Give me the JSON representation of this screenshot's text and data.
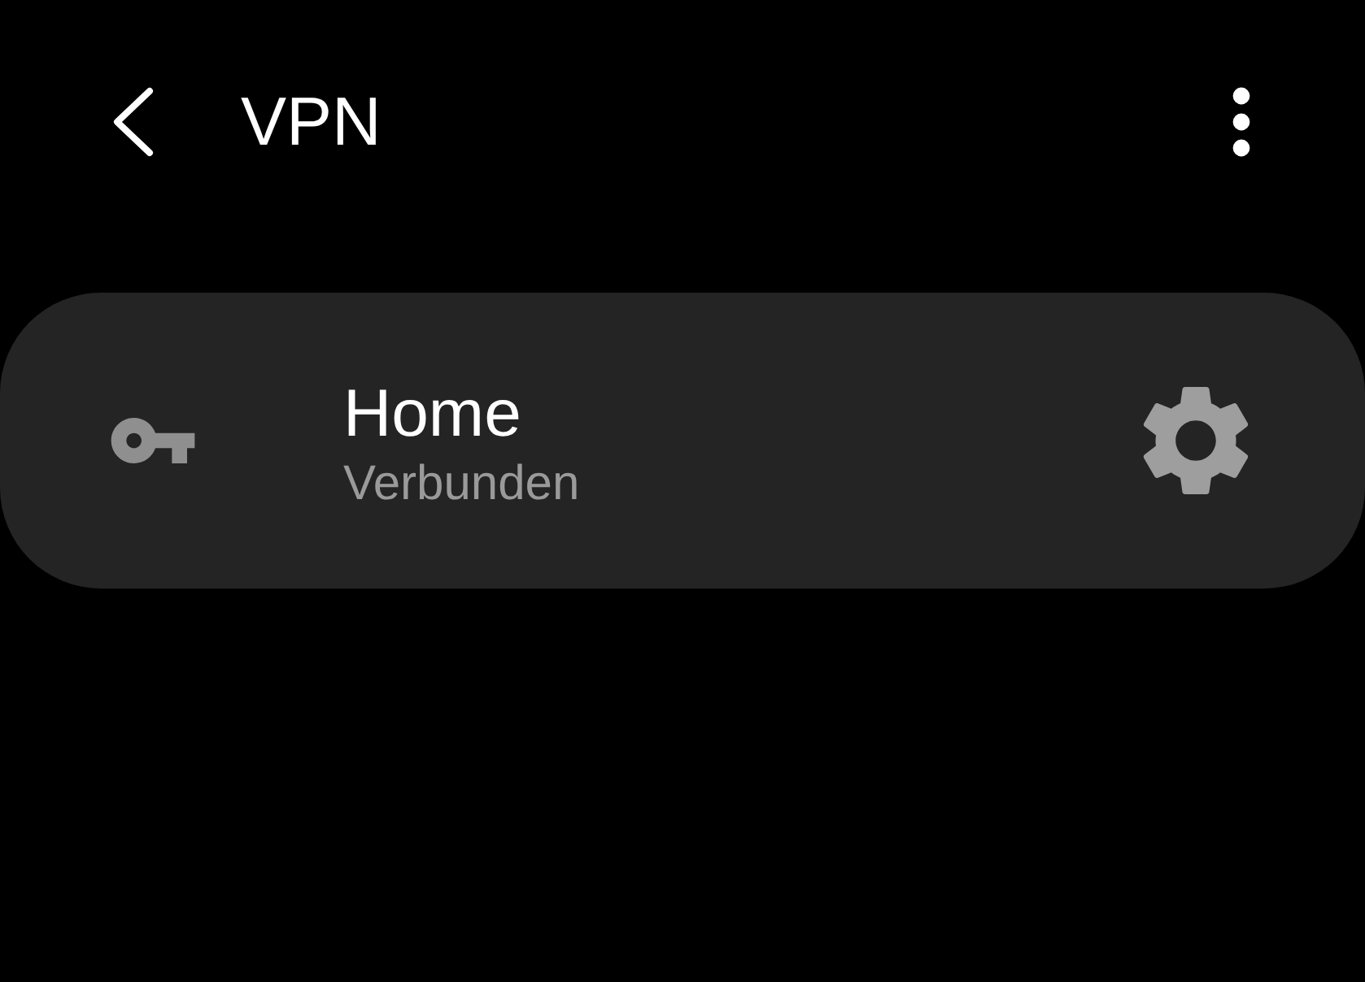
{
  "app_bar": {
    "title": "VPN"
  },
  "vpn_profiles": [
    {
      "name": "Home",
      "status": "Verbunden"
    }
  ]
}
